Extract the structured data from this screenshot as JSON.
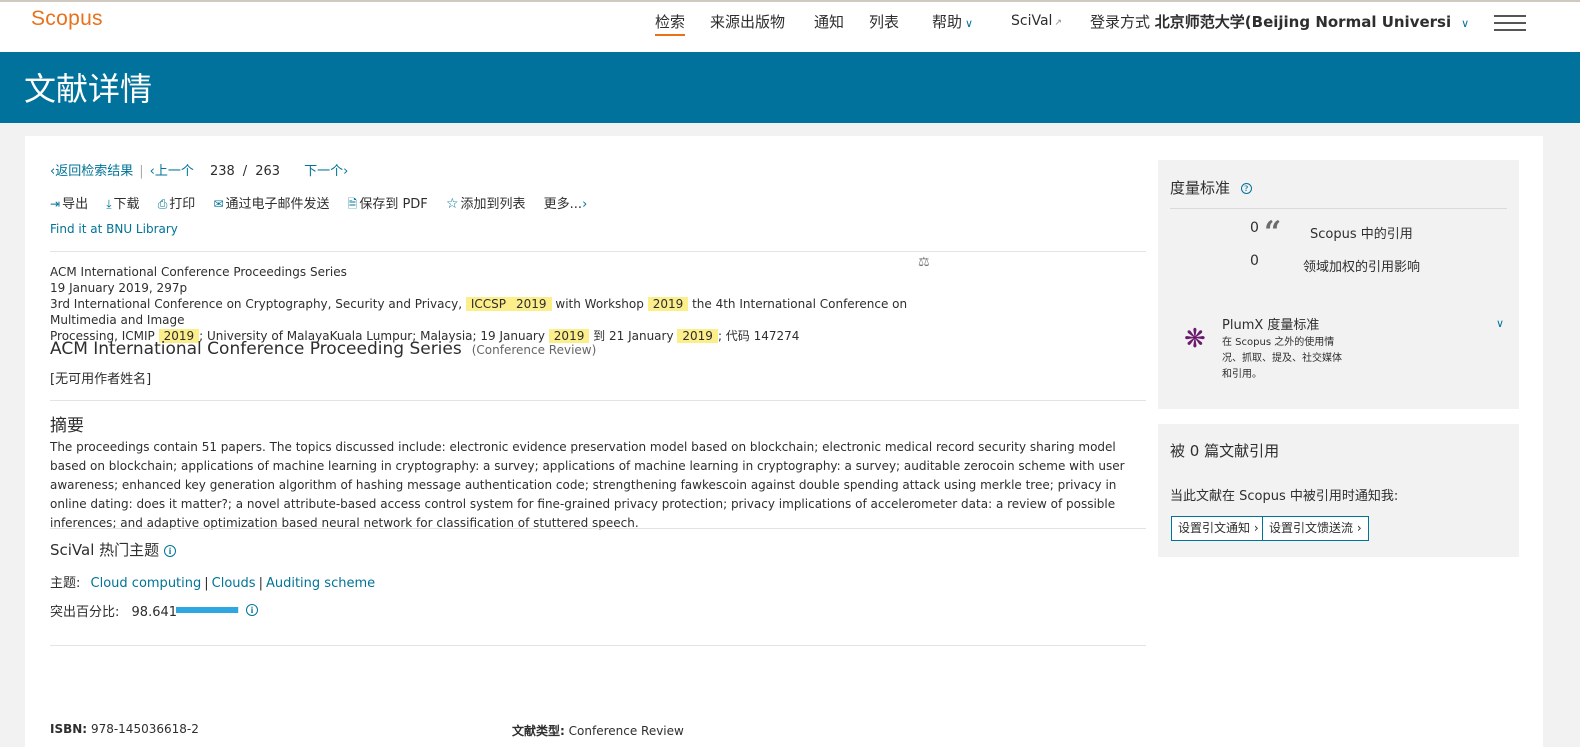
{
  "header": {
    "logo": "Scopus",
    "nav": {
      "search": "检索",
      "sources": "来源出版物",
      "alerts": "通知",
      "lists": "列表",
      "help": "帮助",
      "scival": "SciVal",
      "login_prefix": "登录方式",
      "institution": "北京师范大学(Beijing Normal Universi"
    }
  },
  "page_title": "文献详情",
  "breadcrumb": {
    "back": "返回检索结果",
    "prev": "上一个",
    "current": "238",
    "slash": "/",
    "total": "263",
    "next": "下一个"
  },
  "actions": {
    "export": "导出",
    "download": "下载",
    "print": "打印",
    "email": "通过电子邮件发送",
    "save_pdf": "保存到 PDF",
    "add_list": "添加到列表",
    "more": "更多..."
  },
  "library_link": "Find it at BNU Library",
  "source": {
    "series": "ACM International Conference Proceedings Series",
    "date_pages": "19 January 2019, 297p",
    "conf_a": "3rd International Conference on Cryptography, Security and Privacy,",
    "hl_iccsp": "ICCSP",
    "hl_2019": "2019",
    "conf_b": "with Workshop",
    "conf_c": "the 4th International Conference on Multimedia and Image",
    "conf_d": "Processing, ICMIP",
    "conf_e": "; University of MalayaKuala Lumpur; Malaysia; 19 January",
    "conf_f": "到 21 January",
    "conf_g": "; 代码 147274"
  },
  "document": {
    "title": "ACM International Conference Proceeding Series",
    "type": "(Conference Review)",
    "authors": "[无可用作者姓名]"
  },
  "abstract": {
    "heading": "摘要",
    "text": "The proceedings contain 51 papers. The topics discussed include: electronic evidence preservation model based on blockchain; electronic medical record security sharing model based on blockchain; applications of machine learning in cryptography: a survey; applications of machine learning in cryptography: a survey; auditable zerocoin scheme with user awareness; enhanced key generation algorithm of hashing message authentication code; strengthening fawkescoin against double spending attack using merkle tree; privacy in online dating: does it matter?; a novel attribute-based access control system for fine-grained privacy protection; privacy implications of accelerometer data: a review of possible inferences; and adaptive optimization based neural network for classification of stuttered speech."
  },
  "scival": {
    "heading": "SciVal 热门主题",
    "topic_label": "主题:",
    "topics": [
      "Cloud computing",
      "Clouds",
      "Auditing scheme"
    ],
    "prominence_label": "突出百分比:",
    "prominence_value": "98.641",
    "prominence_fraction": 0.98641
  },
  "bottom": {
    "isbn_label": "ISBN:",
    "isbn": "978-145036618-2",
    "doctype_label": "文献类型:",
    "doctype": "Conference Review"
  },
  "metrics": {
    "heading": "度量标准",
    "scopus_count": "0",
    "scopus_label": "Scopus 中的引用",
    "fwci_count": "0",
    "fwci_label": "领域加权的引用影响",
    "plumx_title": "PlumX 度量标准",
    "plumx_desc": "在 Scopus 之外的使用情况、抓取、提及、社交媒体和引用。"
  },
  "cited_by": {
    "heading": "被 0 篇文献引用",
    "notify": "当此文献在 Scopus 中被引用时通知我:",
    "btn_alert": "设置引文通知",
    "btn_feed": "设置引文馈送流"
  }
}
